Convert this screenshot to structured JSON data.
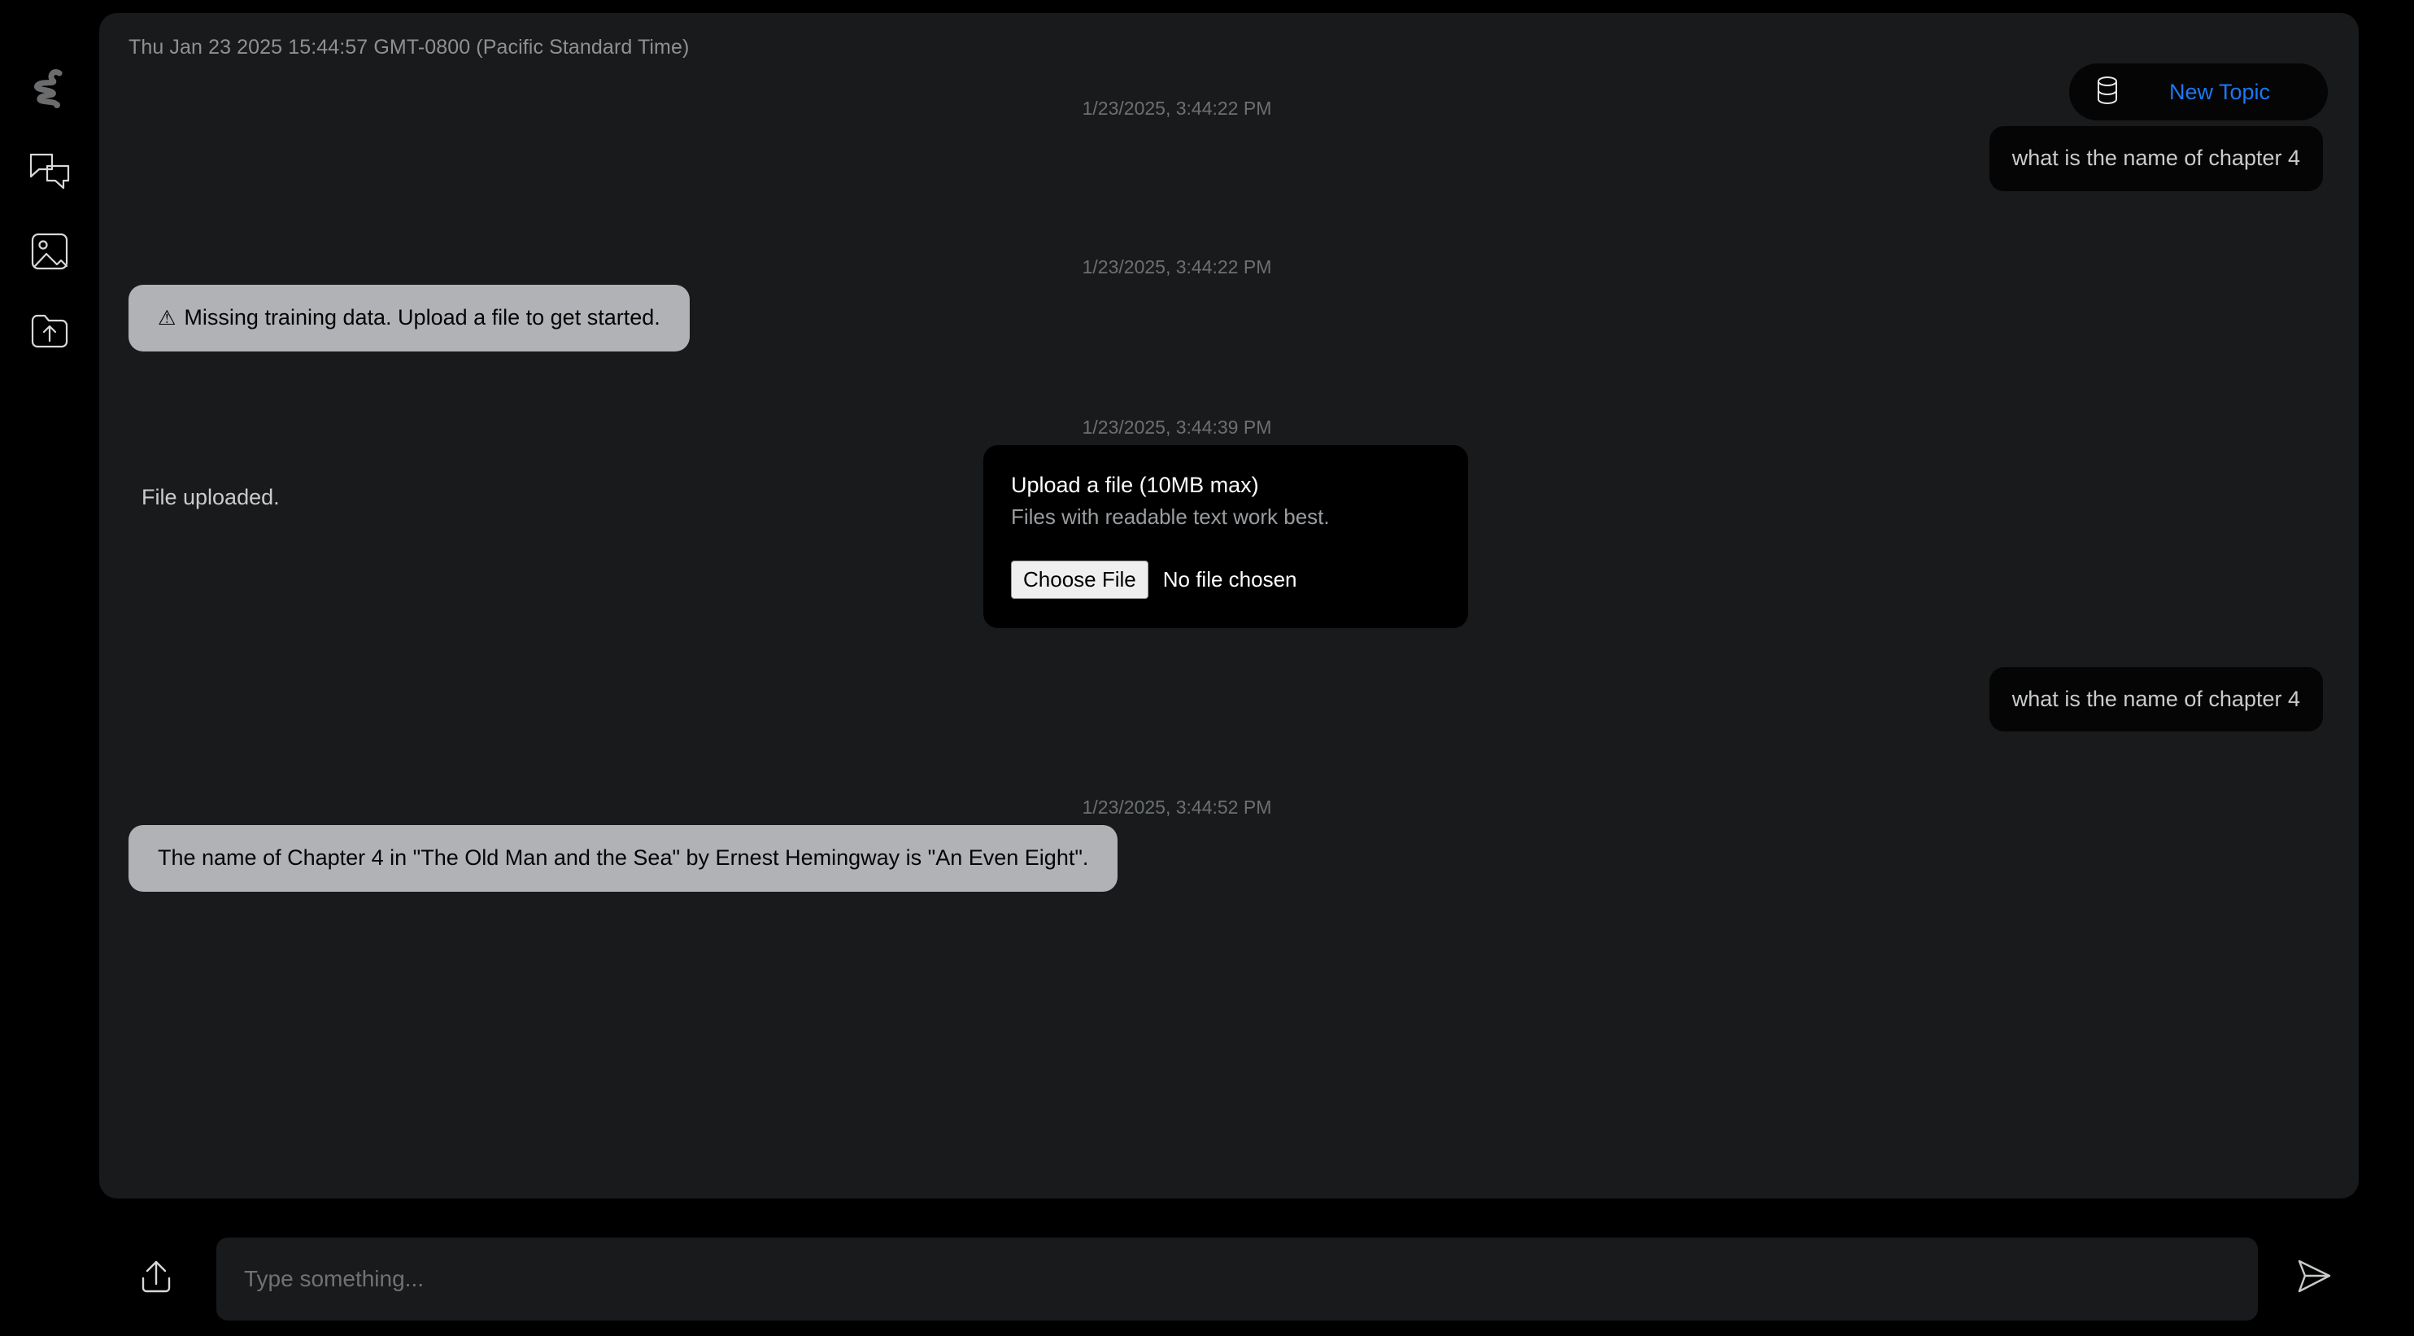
{
  "sidebar": {
    "logo": {
      "icon": "squiggle-logo-icon"
    },
    "items": [
      {
        "icon": "chat-bubbles-icon",
        "name": "chats"
      },
      {
        "icon": "image-icon",
        "name": "images"
      },
      {
        "icon": "folder-upload-icon",
        "name": "uploads"
      }
    ]
  },
  "header": {
    "conversation_date": "Thu Jan 23 2025 15:44:57 GMT-0800 (Pacific Standard Time)",
    "new_topic_label": "New Topic",
    "new_topic_icon": "database-icon",
    "new_topic_color": "#1b78f2"
  },
  "messages": [
    {
      "timestamp": "1/23/2025, 3:44:22 PM",
      "role": "user",
      "text": "what is the name of chapter 4"
    },
    {
      "timestamp": "1/23/2025, 3:44:22 PM",
      "role": "assistant",
      "warning_glyph": "⚠",
      "text": "Missing training data. Upload a file to get started."
    },
    {
      "timestamp": "1/23/2025, 3:44:39 PM",
      "role": "assistant",
      "text": "File uploaded.",
      "card": {
        "title": "Upload a file (10MB max)",
        "subtitle": "Files with readable text work best.",
        "choose_file_label": "Choose File",
        "no_file_label": "No file chosen"
      }
    },
    {
      "role": "user",
      "text": "what is the name of chapter 4"
    },
    {
      "timestamp": "1/23/2025, 3:44:52 PM",
      "role": "assistant",
      "text": "The name of Chapter 4 in \"The Old Man and the Sea\" by Ernest Hemingway is \"An Even Eight\"."
    }
  ],
  "composer": {
    "upload_icon": "upload-arrow-icon",
    "placeholder": "Type something...",
    "value": "",
    "send_icon": "send-paper-plane-icon"
  },
  "colors": {
    "page_background": "#000000",
    "panel_background": "#181a1b",
    "user_bubble": "#050505",
    "assistant_bubble": "#b0b2b5",
    "accent_blue": "#1b78f2",
    "muted_text": "#6d7073"
  }
}
